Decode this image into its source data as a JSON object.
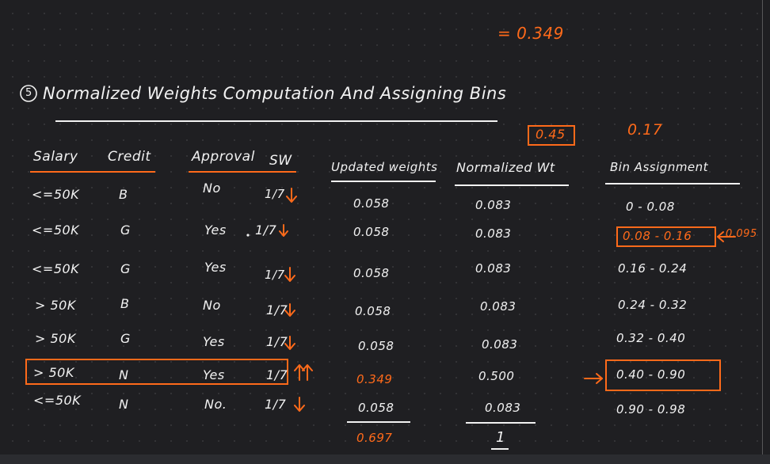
{
  "top_result": "= 0.349",
  "section": {
    "number": "5",
    "title": "Normalized Weights Computation And Assigning Bins"
  },
  "annotations": {
    "boxed_value": "0.45",
    "value_017": "0.17",
    "side_value": "0.095"
  },
  "table": {
    "headers": {
      "salary": "Salary",
      "credit": "Credit",
      "approval": "Approval",
      "sw": "SW",
      "updated": "Updated weights",
      "normalized": "Normalized Wt",
      "bin": "Bin Assignment"
    },
    "rows": [
      {
        "salary": "<=50K",
        "credit": "B",
        "approval": "No",
        "sw": "1/7",
        "updated": "0.058",
        "normalized": "0.083",
        "bin": "0 - 0.08"
      },
      {
        "salary": "<=50K",
        "credit": "G",
        "approval": "Yes",
        "sw": "1/7",
        "updated": "0.058",
        "normalized": "0.083",
        "bin": "0.08 - 0.16"
      },
      {
        "salary": "<=50K",
        "credit": "G",
        "approval": "Yes",
        "sw": "1/7",
        "updated": "0.058",
        "normalized": "0.083",
        "bin": "0.16 - 0.24"
      },
      {
        "salary": "> 50K",
        "credit": "B",
        "approval": "No",
        "sw": "1/7",
        "updated": "0.058",
        "normalized": "0.083",
        "bin": "0.24 - 0.32"
      },
      {
        "salary": "> 50K",
        "credit": "G",
        "approval": "Yes",
        "sw": "1/7",
        "updated": "0.058",
        "normalized": "0.083",
        "bin": "0.32 - 0.40"
      },
      {
        "salary": "> 50K",
        "credit": "N",
        "approval": "Yes",
        "sw": "1/7",
        "updated": "0.349",
        "normalized": "0.500",
        "bin": "0.40 - 0.90"
      },
      {
        "salary": "<=50K",
        "credit": "N",
        "approval": "No.",
        "sw": "1/7",
        "updated": "0.058",
        "normalized": "0.083",
        "bin": "0.90 - 0.98"
      }
    ],
    "totals": {
      "updated_sum": "0.697",
      "normalized_sum": "1"
    }
  },
  "colors": {
    "background": "#1f1f22",
    "ink": "#f2f2f2",
    "accent": "#ff6a1a"
  },
  "icons": {
    "down_arrow": "down-arrow",
    "up_arrow": "double-up-arrow",
    "left_arrow": "left-arrow",
    "right_arrow": "right-arrow"
  }
}
